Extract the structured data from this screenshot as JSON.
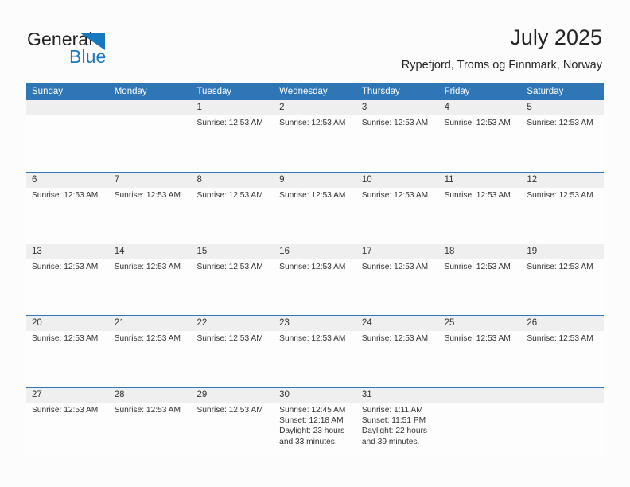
{
  "brand": {
    "name_part1": "General",
    "name_part2": "Blue",
    "triangle_color": "#1878be"
  },
  "header": {
    "title": "July 2025",
    "subtitle": "Rypefjord, Troms og Finnmark, Norway"
  },
  "theme": {
    "header_blue": "#2e76b6",
    "date_band": "#efefef",
    "page_background": "#fcfcfd",
    "text": "#222222"
  },
  "weekdays": [
    "Sunday",
    "Monday",
    "Tuesday",
    "Wednesday",
    "Thursday",
    "Friday",
    "Saturday"
  ],
  "weeks": [
    {
      "days": [
        {
          "date": "",
          "lines": []
        },
        {
          "date": "",
          "lines": []
        },
        {
          "date": "1",
          "lines": [
            "Sunrise: 12:53 AM"
          ]
        },
        {
          "date": "2",
          "lines": [
            "Sunrise: 12:53 AM"
          ]
        },
        {
          "date": "3",
          "lines": [
            "Sunrise: 12:53 AM"
          ]
        },
        {
          "date": "4",
          "lines": [
            "Sunrise: 12:53 AM"
          ]
        },
        {
          "date": "5",
          "lines": [
            "Sunrise: 12:53 AM"
          ]
        }
      ]
    },
    {
      "days": [
        {
          "date": "6",
          "lines": [
            "Sunrise: 12:53 AM"
          ]
        },
        {
          "date": "7",
          "lines": [
            "Sunrise: 12:53 AM"
          ]
        },
        {
          "date": "8",
          "lines": [
            "Sunrise: 12:53 AM"
          ]
        },
        {
          "date": "9",
          "lines": [
            "Sunrise: 12:53 AM"
          ]
        },
        {
          "date": "10",
          "lines": [
            "Sunrise: 12:53 AM"
          ]
        },
        {
          "date": "11",
          "lines": [
            "Sunrise: 12:53 AM"
          ]
        },
        {
          "date": "12",
          "lines": [
            "Sunrise: 12:53 AM"
          ]
        }
      ]
    },
    {
      "days": [
        {
          "date": "13",
          "lines": [
            "Sunrise: 12:53 AM"
          ]
        },
        {
          "date": "14",
          "lines": [
            "Sunrise: 12:53 AM"
          ]
        },
        {
          "date": "15",
          "lines": [
            "Sunrise: 12:53 AM"
          ]
        },
        {
          "date": "16",
          "lines": [
            "Sunrise: 12:53 AM"
          ]
        },
        {
          "date": "17",
          "lines": [
            "Sunrise: 12:53 AM"
          ]
        },
        {
          "date": "18",
          "lines": [
            "Sunrise: 12:53 AM"
          ]
        },
        {
          "date": "19",
          "lines": [
            "Sunrise: 12:53 AM"
          ]
        }
      ]
    },
    {
      "days": [
        {
          "date": "20",
          "lines": [
            "Sunrise: 12:53 AM"
          ]
        },
        {
          "date": "21",
          "lines": [
            "Sunrise: 12:53 AM"
          ]
        },
        {
          "date": "22",
          "lines": [
            "Sunrise: 12:53 AM"
          ]
        },
        {
          "date": "23",
          "lines": [
            "Sunrise: 12:53 AM"
          ]
        },
        {
          "date": "24",
          "lines": [
            "Sunrise: 12:53 AM"
          ]
        },
        {
          "date": "25",
          "lines": [
            "Sunrise: 12:53 AM"
          ]
        },
        {
          "date": "26",
          "lines": [
            "Sunrise: 12:53 AM"
          ]
        }
      ]
    },
    {
      "days": [
        {
          "date": "27",
          "lines": [
            "Sunrise: 12:53 AM"
          ]
        },
        {
          "date": "28",
          "lines": [
            "Sunrise: 12:53 AM"
          ]
        },
        {
          "date": "29",
          "lines": [
            "Sunrise: 12:53 AM"
          ]
        },
        {
          "date": "30",
          "lines": [
            "Sunrise: 12:45 AM",
            "Sunset: 12:18 AM",
            "Daylight: 23 hours and 33 minutes."
          ]
        },
        {
          "date": "31",
          "lines": [
            "Sunrise: 1:11 AM",
            "Sunset: 11:51 PM",
            "Daylight: 22 hours and 39 minutes."
          ]
        },
        {
          "date": "",
          "lines": []
        },
        {
          "date": "",
          "lines": []
        }
      ]
    }
  ]
}
